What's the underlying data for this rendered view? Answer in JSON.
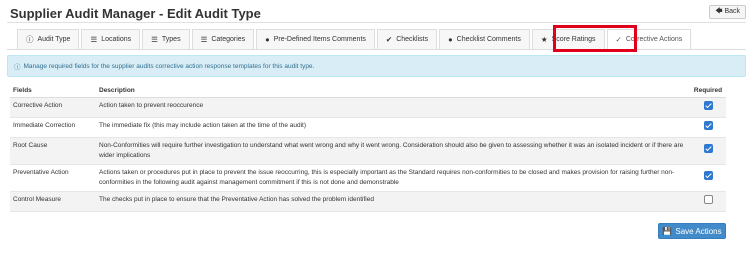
{
  "page": {
    "title": "Supplier Audit Manager - Edit Audit Type",
    "back_label": "Back"
  },
  "tabs": [
    {
      "label": "Audit Type",
      "icon": "info-circle-icon"
    },
    {
      "label": "Locations",
      "icon": "list-icon"
    },
    {
      "label": "Types",
      "icon": "list-icon"
    },
    {
      "label": "Categories",
      "icon": "list-icon"
    },
    {
      "label": "Pre-Defined Items Comments",
      "icon": "comments-icon"
    },
    {
      "label": "Checklists",
      "icon": "check-circle-icon"
    },
    {
      "label": "Checklist Comments",
      "icon": "comments-icon"
    },
    {
      "label": "Score Ratings",
      "icon": "star-icon"
    },
    {
      "label": "Corrective Actions",
      "icon": "check-icon",
      "active": true
    }
  ],
  "alert": {
    "text": "Manage required fields for the supplier audits corrective action response templates for this audit type."
  },
  "table": {
    "headers": {
      "fields": "Fields",
      "description": "Description",
      "required": "Required"
    },
    "rows": [
      {
        "field": "Corrective Action",
        "description": "Action taken to prevent reoccurence",
        "required": true
      },
      {
        "field": "Immediate Correction",
        "description": "The immediate fix (this may include action taken at the time of the audit)",
        "required": true
      },
      {
        "field": "Root Cause",
        "description": "Non-Conformities will require further investigation to understand what went wrong and why it went wrong. Consideration should also be given to assessing whether it was an isolated incident or if there are wider implications",
        "required": true
      },
      {
        "field": "Preventative Action",
        "description": "Actions taken or procedures put in place to prevent the issue reoccurring, this is especially important as the Standard requires non-conformities to be closed and makes provision for raising further non-conformities in the following audit against management commitment if this is not done and demonstrable",
        "required": true
      },
      {
        "field": "Control Measure",
        "description": "The checks put in place to ensure that the Preventative Action has solved the problem identified",
        "required": false
      }
    ]
  },
  "save_label": "Save Actions",
  "colors": {
    "highlight": "#e0001b",
    "primary": "#428bca",
    "alert_bg": "#d9edf7"
  }
}
